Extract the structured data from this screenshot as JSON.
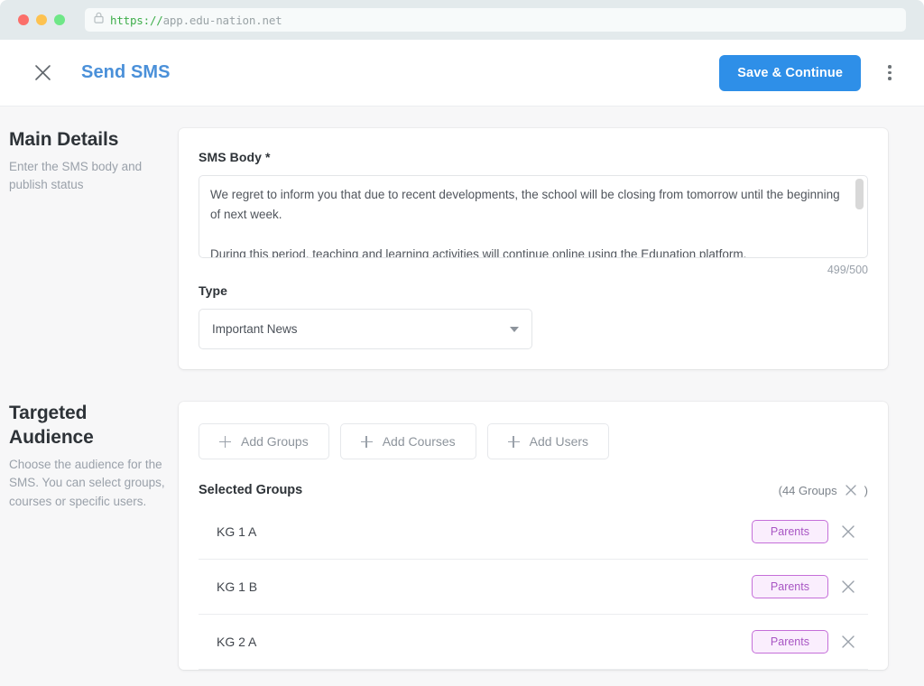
{
  "browser": {
    "url_scheme": "https://",
    "url_host": "app.edu-nation.net",
    "lock_icon": "lock-icon"
  },
  "header": {
    "close_icon": "close-icon",
    "title": "Send SMS",
    "save_label": "Save & Continue",
    "menu_icon": "kebab-menu-icon",
    "accent_color": "#2e8fe8",
    "title_color": "#4a90d9"
  },
  "main_details": {
    "heading": "Main Details",
    "description": "Enter the SMS body and publish status",
    "sms_body_label": "SMS Body *",
    "sms_body_value": "We regret to inform you that due to recent developments, the school will be closing from tomorrow until the beginning of next week.\n\nDuring this period, teaching and learning activities will continue online using the Edunation platform.",
    "char_counter": "499/500",
    "type_label": "Type",
    "type_value": "Important News",
    "type_caret_icon": "chevron-down-icon"
  },
  "targeted_audience": {
    "heading": "Targeted Audience",
    "description": "Choose the audience for the SMS. You can select groups, courses or specific users.",
    "add_buttons": [
      {
        "label": "Add Groups",
        "icon": "plus-icon"
      },
      {
        "label": "Add Courses",
        "icon": "plus-icon"
      },
      {
        "label": "Add Users",
        "icon": "plus-icon"
      }
    ],
    "selected_title": "Selected Groups",
    "count_open": "(44 Groups",
    "count_close": ")",
    "count_clear_icon": "close-icon",
    "badge_color": "#a855c4",
    "badge_bg": "#faeefd",
    "groups": [
      {
        "name": "KG 1 A",
        "badge": "Parents",
        "remove_icon": "close-icon"
      },
      {
        "name": "KG 1 B",
        "badge": "Parents",
        "remove_icon": "close-icon"
      },
      {
        "name": "KG 2 A",
        "badge": "Parents",
        "remove_icon": "close-icon"
      }
    ]
  }
}
